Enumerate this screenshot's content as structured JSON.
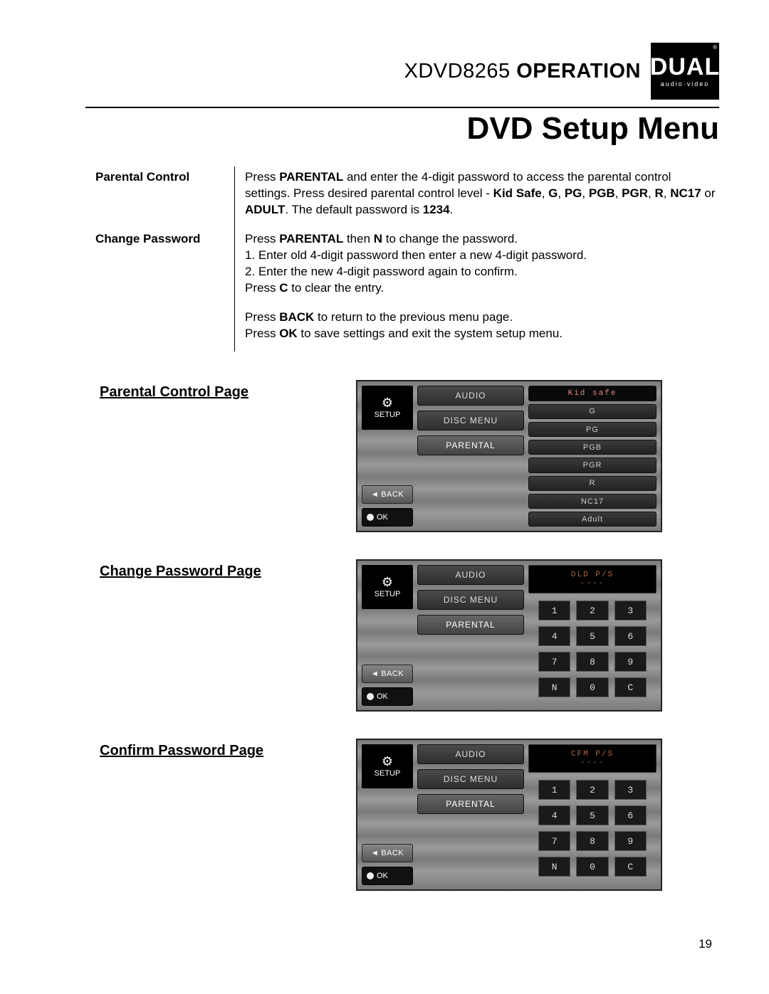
{
  "header": {
    "model": "XDVD8265",
    "operation": "OPERATION"
  },
  "logo": {
    "brand": "DUAL",
    "sub": "audio·video",
    "reg": "®"
  },
  "page_title": "DVD Setup Menu",
  "desc": {
    "row1_label": "Parental Control",
    "row1_text_a": "Press ",
    "row1_b1": "PARENTAL",
    "row1_text_b": " and enter the 4-digit password to access the parental control settings. Press desired parental control level - ",
    "row1_b2": "Kid Safe",
    "row1_c1": ", ",
    "row1_b3": "G",
    "row1_c2": ", ",
    "row1_b4": "PG",
    "row1_c3": ", ",
    "row1_b5": "PGB",
    "row1_c4": ", ",
    "row1_b6": "PGR",
    "row1_c5": ", ",
    "row1_b7": "R",
    "row1_c6": ", ",
    "row1_b8": "NC17",
    "row1_c7": " or ",
    "row1_b9": "ADULT",
    "row1_text_c": ". The default password is ",
    "row1_b10": "1234",
    "row1_text_d": ".",
    "row2_label": "Change Password",
    "row2_a": "Press ",
    "row2_b1": "PARENTAL",
    "row2_b": " then ",
    "row2_b2": "N",
    "row2_c": " to change the password.",
    "row2_l1": "1. Enter old 4-digit password then enter a new 4-digit password.",
    "row2_l2": "2. Enter the new 4-digit password again to confirm.",
    "row2_d": "Press ",
    "row2_b3": "C",
    "row2_e": " to clear the entry.",
    "row3_a": "Press ",
    "row3_b1": "BACK",
    "row3_b": " to return to the previous menu page.",
    "row3_c": "Press ",
    "row3_b2": "OK",
    "row3_d": " to save settings and exit the system setup menu."
  },
  "screens": {
    "s1_label": "Parental Control Page",
    "s2_label": "Change Password Page",
    "s3_label": "Confirm Password Page",
    "setup": "SETUP",
    "back": "BACK",
    "ok": "OK",
    "menu": {
      "audio": "AUDIO",
      "disc": "DISC MENU",
      "parental": "PARENTAL"
    },
    "ratings": [
      "Kid safe",
      "G",
      "PG",
      "PGB",
      "PGR",
      "R",
      "NC17",
      "Adult"
    ],
    "lcd_old": "OLD P/S",
    "lcd_cfm": "CFM P/S",
    "lcd_dash": "----",
    "keys": [
      "1",
      "2",
      "3",
      "4",
      "5",
      "6",
      "7",
      "8",
      "9",
      "N",
      "0",
      "C"
    ]
  },
  "page_number": "19"
}
